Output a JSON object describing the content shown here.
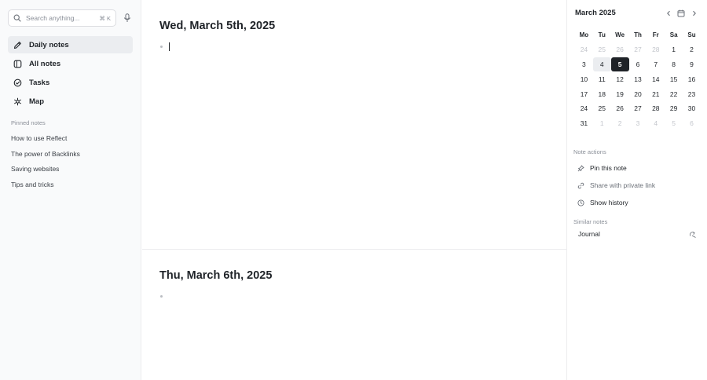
{
  "sidebar": {
    "search": {
      "placeholder": "Search anything...",
      "shortcut": "⌘ K",
      "icon": "search-icon"
    },
    "mic_icon": "microphone-icon",
    "nav": [
      {
        "label": "Daily notes",
        "icon": "pen-icon",
        "active": true
      },
      {
        "label": "All notes",
        "icon": "notes-icon",
        "active": false
      },
      {
        "label": "Tasks",
        "icon": "check-circle-icon",
        "active": false
      },
      {
        "label": "Map",
        "icon": "network-icon",
        "active": false
      }
    ],
    "pinned_header": "Pinned notes",
    "pinned": [
      "How to use Reflect",
      "The power of Backlinks",
      "Saving websites",
      "Tips and tricks"
    ]
  },
  "main": {
    "days": [
      {
        "title": "Wed, March 5th, 2025"
      },
      {
        "title": "Thu, March 6th, 2025"
      }
    ]
  },
  "right": {
    "calendar": {
      "title": "March 2025",
      "weekdays": [
        "Mo",
        "Tu",
        "We",
        "Th",
        "Fr",
        "Sa",
        "Su"
      ],
      "weeks": [
        [
          "24",
          "25",
          "26",
          "27",
          "28",
          "1",
          "2"
        ],
        [
          "3",
          "4",
          "5",
          "6",
          "7",
          "8",
          "9"
        ],
        [
          "10",
          "11",
          "12",
          "13",
          "14",
          "15",
          "16"
        ],
        [
          "17",
          "18",
          "19",
          "20",
          "21",
          "22",
          "23"
        ],
        [
          "24",
          "25",
          "26",
          "27",
          "28",
          "29",
          "30"
        ],
        [
          "31",
          "1",
          "2",
          "3",
          "4",
          "5",
          "6"
        ]
      ],
      "today": "4",
      "selected": "5"
    },
    "note_actions_label": "Note actions",
    "actions": [
      {
        "label": "Pin this note",
        "icon": "pin-icon"
      },
      {
        "label": "Share with private link",
        "icon": "link-icon"
      },
      {
        "label": "Show history",
        "icon": "clock-icon"
      }
    ],
    "similar_label": "Similar notes",
    "similar": [
      {
        "label": "Journal",
        "icon": "open-link-icon"
      }
    ]
  },
  "colors": {
    "text": "#1f2328",
    "muted": "#8a8f98",
    "selected_bg": "#1f2328",
    "sidebar_bg": "#f9fafb",
    "border": "#ececee"
  }
}
